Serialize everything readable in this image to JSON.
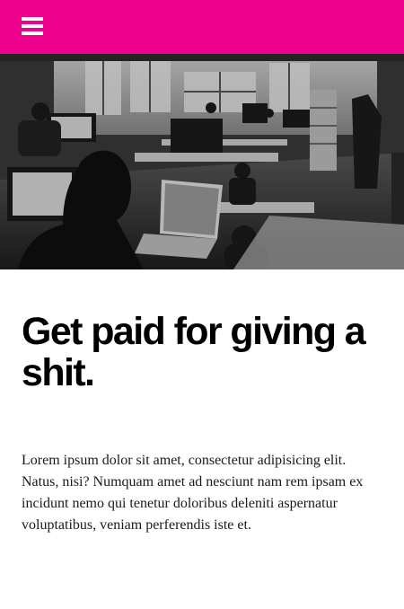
{
  "header": {
    "background_color": "#ec008c",
    "menu_icon": "hamburger-menu-icon"
  },
  "hero": {
    "description_icon": "office-photo"
  },
  "main": {
    "headline": "Get paid for giving a shit.",
    "body": "Lorem ipsum dolor sit amet, consectetur adipisicing elit. Natus, nisi? Numquam amet ad nesciunt nam rem ipsam ex incidunt nemo qui tenetur doloribus deleniti aspernatur voluptatibus, veniam perferendis iste et."
  }
}
